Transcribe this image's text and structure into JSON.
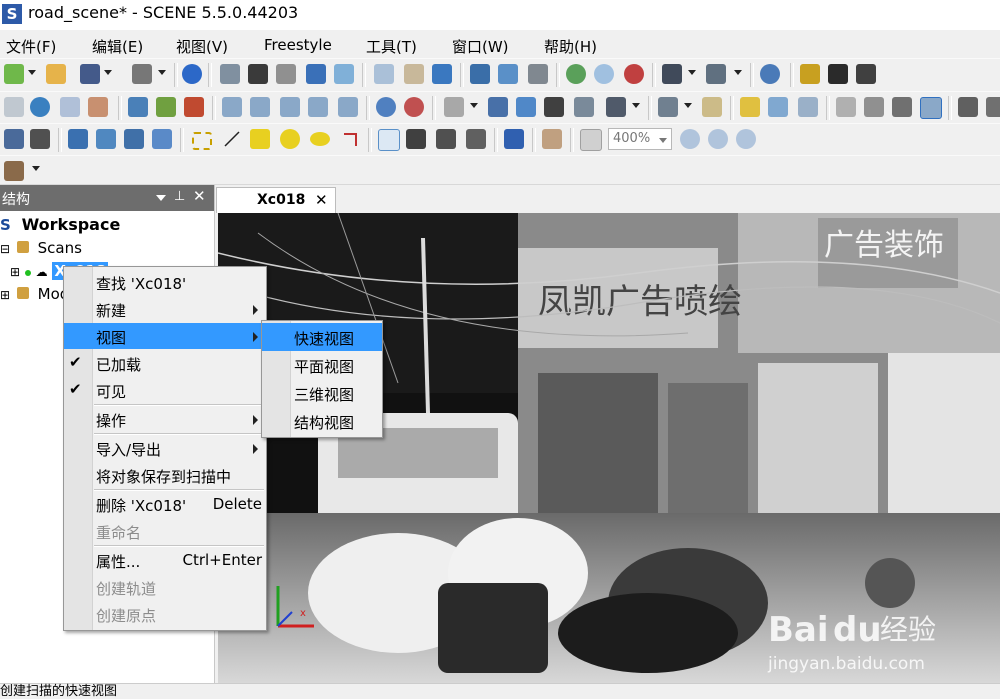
{
  "window": {
    "title": "road_scene* - SCENE 5.5.0.44203",
    "app_icon_letter": "S"
  },
  "menubar": [
    "文件(F)",
    "编辑(E)",
    "视图(V)",
    "Freestyle",
    "工具(T)",
    "窗口(W)",
    "帮助(H)"
  ],
  "toolbar": {
    "zoom_value": "400%"
  },
  "panel": {
    "title": "结构",
    "tree": {
      "workspace_label": "Workspace",
      "scans_label": "Scans",
      "scan_item_label": "Xc018",
      "models_label": "Mod"
    }
  },
  "view_tab": {
    "label": "Xc018"
  },
  "context_menu": {
    "items": [
      {
        "label": "查找 'Xc018'"
      },
      {
        "label": "新建"
      },
      {
        "label": "视图"
      },
      {
        "label": "已加载"
      },
      {
        "label": "可见"
      },
      {
        "label": "操作"
      },
      {
        "label": "导入/导出"
      },
      {
        "label": "将对象保存到扫描中"
      },
      {
        "label": "删除 'Xc018'",
        "shortcut": "Delete"
      },
      {
        "label": "重命名"
      },
      {
        "label": "属性...",
        "shortcut": "Ctrl+Enter"
      },
      {
        "label": "创建轨道"
      },
      {
        "label": "创建原点"
      }
    ],
    "checks": [
      "✔",
      "✔"
    ]
  },
  "submenu": {
    "items": [
      "快速视图",
      "平面视图",
      "三维视图",
      "结构视图"
    ]
  },
  "viewport_signs": {
    "shop_sign": "凤凯广告喷绘",
    "right_sign": "广告装饰"
  },
  "watermark": {
    "brand": "Bai",
    "brand2": "du",
    "brand_cn": "经验",
    "url": "jingyan.baidu.com"
  },
  "status": {
    "text": "创建扫描的快速视图"
  },
  "colors": {
    "highlight": "#3399ff",
    "panel_header": "#6d6d6d",
    "title_icon": "#2d5aa8"
  }
}
